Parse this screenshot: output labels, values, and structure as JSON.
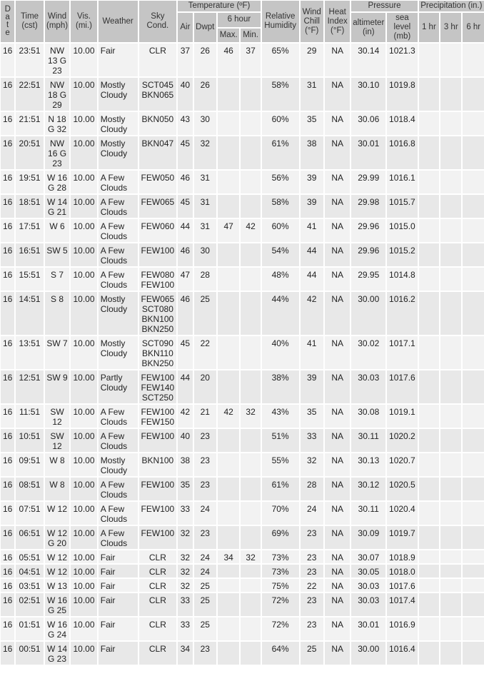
{
  "headers": {
    "date": "D a t e",
    "time": "Time (cst)",
    "wind": "Wind (mph)",
    "vis": "Vis. (mi.)",
    "weather": "Weather",
    "sky": "Sky Cond.",
    "temperature": "Temperature (ºF)",
    "air": "Air",
    "dwpt": "Dwpt",
    "six_hour": "6 hour",
    "max": "Max.",
    "min": "Min.",
    "humidity": "Relative Humidity",
    "wind_chill": "Wind Chill (°F)",
    "heat_index": "Heat Index (°F)",
    "pressure": "Pressure",
    "altimeter": "altimeter (in)",
    "sea_level": "sea level (mb)",
    "precipitation": "Precipitation (in.)",
    "p1": "1 hr",
    "p3": "3 hr",
    "p6": "6 hr"
  },
  "rows": [
    {
      "date": "16",
      "time": "23:51",
      "wind": "NW 13 G 23",
      "vis": "10.00",
      "weather": "Fair",
      "sky": [
        "CLR"
      ],
      "air": "37",
      "dwpt": "26",
      "max": "46",
      "min": "37",
      "rh": "65%",
      "chill": "29",
      "heat": "NA",
      "alt": "30.14",
      "sea": "1021.3",
      "p1": "",
      "p3": "",
      "p6": ""
    },
    {
      "date": "16",
      "time": "22:51",
      "wind": "NW 18 G 29",
      "vis": "10.00",
      "weather": "Mostly Cloudy",
      "sky": [
        "SCT045",
        "BKN065"
      ],
      "air": "40",
      "dwpt": "26",
      "max": "",
      "min": "",
      "rh": "58%",
      "chill": "31",
      "heat": "NA",
      "alt": "30.10",
      "sea": "1019.8",
      "p1": "",
      "p3": "",
      "p6": ""
    },
    {
      "date": "16",
      "time": "21:51",
      "wind": "N 18 G 32",
      "vis": "10.00",
      "weather": "Mostly Cloudy",
      "sky": [
        "BKN050"
      ],
      "air": "43",
      "dwpt": "30",
      "max": "",
      "min": "",
      "rh": "60%",
      "chill": "35",
      "heat": "NA",
      "alt": "30.06",
      "sea": "1018.4",
      "p1": "",
      "p3": "",
      "p6": ""
    },
    {
      "date": "16",
      "time": "20:51",
      "wind": "NW 16 G 23",
      "vis": "10.00",
      "weather": "Mostly Cloudy",
      "sky": [
        "BKN047"
      ],
      "air": "45",
      "dwpt": "32",
      "max": "",
      "min": "",
      "rh": "61%",
      "chill": "38",
      "heat": "NA",
      "alt": "30.01",
      "sea": "1016.8",
      "p1": "",
      "p3": "",
      "p6": ""
    },
    {
      "date": "16",
      "time": "19:51",
      "wind": "W 16 G 28",
      "vis": "10.00",
      "weather": "A Few Clouds",
      "sky": [
        "FEW050"
      ],
      "air": "46",
      "dwpt": "31",
      "max": "",
      "min": "",
      "rh": "56%",
      "chill": "39",
      "heat": "NA",
      "alt": "29.99",
      "sea": "1016.1",
      "p1": "",
      "p3": "",
      "p6": ""
    },
    {
      "date": "16",
      "time": "18:51",
      "wind": "W 14 G 21",
      "vis": "10.00",
      "weather": "A Few Clouds",
      "sky": [
        "FEW065"
      ],
      "air": "45",
      "dwpt": "31",
      "max": "",
      "min": "",
      "rh": "58%",
      "chill": "39",
      "heat": "NA",
      "alt": "29.98",
      "sea": "1015.7",
      "p1": "",
      "p3": "",
      "p6": ""
    },
    {
      "date": "16",
      "time": "17:51",
      "wind": "W 6",
      "vis": "10.00",
      "weather": "A Few Clouds",
      "sky": [
        "FEW060"
      ],
      "air": "44",
      "dwpt": "31",
      "max": "47",
      "min": "42",
      "rh": "60%",
      "chill": "41",
      "heat": "NA",
      "alt": "29.96",
      "sea": "1015.0",
      "p1": "",
      "p3": "",
      "p6": ""
    },
    {
      "date": "16",
      "time": "16:51",
      "wind": "SW 5",
      "vis": "10.00",
      "weather": "A Few Clouds",
      "sky": [
        "FEW100"
      ],
      "air": "46",
      "dwpt": "30",
      "max": "",
      "min": "",
      "rh": "54%",
      "chill": "44",
      "heat": "NA",
      "alt": "29.96",
      "sea": "1015.2",
      "p1": "",
      "p3": "",
      "p6": ""
    },
    {
      "date": "16",
      "time": "15:51",
      "wind": "S 7",
      "vis": "10.00",
      "weather": "A Few Clouds",
      "sky": [
        "FEW080",
        "FEW100"
      ],
      "air": "47",
      "dwpt": "28",
      "max": "",
      "min": "",
      "rh": "48%",
      "chill": "44",
      "heat": "NA",
      "alt": "29.95",
      "sea": "1014.8",
      "p1": "",
      "p3": "",
      "p6": ""
    },
    {
      "date": "16",
      "time": "14:51",
      "wind": "S 8",
      "vis": "10.00",
      "weather": "Mostly Cloudy",
      "sky": [
        "FEW065",
        "SCT080",
        "BKN100",
        "BKN250"
      ],
      "air": "46",
      "dwpt": "25",
      "max": "",
      "min": "",
      "rh": "44%",
      "chill": "42",
      "heat": "NA",
      "alt": "30.00",
      "sea": "1016.2",
      "p1": "",
      "p3": "",
      "p6": ""
    },
    {
      "date": "16",
      "time": "13:51",
      "wind": "SW 7",
      "vis": "10.00",
      "weather": "Mostly Cloudy",
      "sky": [
        "SCT090",
        "BKN110",
        "BKN250"
      ],
      "air": "45",
      "dwpt": "22",
      "max": "",
      "min": "",
      "rh": "40%",
      "chill": "41",
      "heat": "NA",
      "alt": "30.02",
      "sea": "1017.1",
      "p1": "",
      "p3": "",
      "p6": ""
    },
    {
      "date": "16",
      "time": "12:51",
      "wind": "SW 9",
      "vis": "10.00",
      "weather": "Partly Cloudy",
      "sky": [
        "FEW100",
        "FEW140",
        "SCT250"
      ],
      "air": "44",
      "dwpt": "20",
      "max": "",
      "min": "",
      "rh": "38%",
      "chill": "39",
      "heat": "NA",
      "alt": "30.03",
      "sea": "1017.6",
      "p1": "",
      "p3": "",
      "p6": ""
    },
    {
      "date": "16",
      "time": "11:51",
      "wind": "SW 12",
      "vis": "10.00",
      "weather": "A Few Clouds",
      "sky": [
        "FEW100",
        "FEW150"
      ],
      "air": "42",
      "dwpt": "21",
      "max": "42",
      "min": "32",
      "rh": "43%",
      "chill": "35",
      "heat": "NA",
      "alt": "30.08",
      "sea": "1019.1",
      "p1": "",
      "p3": "",
      "p6": ""
    },
    {
      "date": "16",
      "time": "10:51",
      "wind": "SW 12",
      "vis": "10.00",
      "weather": "A Few Clouds",
      "sky": [
        "FEW100"
      ],
      "air": "40",
      "dwpt": "23",
      "max": "",
      "min": "",
      "rh": "51%",
      "chill": "33",
      "heat": "NA",
      "alt": "30.11",
      "sea": "1020.2",
      "p1": "",
      "p3": "",
      "p6": ""
    },
    {
      "date": "16",
      "time": "09:51",
      "wind": "W 8",
      "vis": "10.00",
      "weather": "Mostly Cloudy",
      "sky": [
        "BKN100"
      ],
      "air": "38",
      "dwpt": "23",
      "max": "",
      "min": "",
      "rh": "55%",
      "chill": "32",
      "heat": "NA",
      "alt": "30.13",
      "sea": "1020.7",
      "p1": "",
      "p3": "",
      "p6": ""
    },
    {
      "date": "16",
      "time": "08:51",
      "wind": "W 8",
      "vis": "10.00",
      "weather": "A Few Clouds",
      "sky": [
        "FEW100"
      ],
      "air": "35",
      "dwpt": "23",
      "max": "",
      "min": "",
      "rh": "61%",
      "chill": "28",
      "heat": "NA",
      "alt": "30.12",
      "sea": "1020.5",
      "p1": "",
      "p3": "",
      "p6": ""
    },
    {
      "date": "16",
      "time": "07:51",
      "wind": "W 12",
      "vis": "10.00",
      "weather": "A Few Clouds",
      "sky": [
        "FEW100"
      ],
      "air": "33",
      "dwpt": "24",
      "max": "",
      "min": "",
      "rh": "70%",
      "chill": "24",
      "heat": "NA",
      "alt": "30.11",
      "sea": "1020.4",
      "p1": "",
      "p3": "",
      "p6": ""
    },
    {
      "date": "16",
      "time": "06:51",
      "wind": "W 12 G 20",
      "vis": "10.00",
      "weather": "A Few Clouds",
      "sky": [
        "FEW100"
      ],
      "air": "32",
      "dwpt": "23",
      "max": "",
      "min": "",
      "rh": "69%",
      "chill": "23",
      "heat": "NA",
      "alt": "30.09",
      "sea": "1019.7",
      "p1": "",
      "p3": "",
      "p6": ""
    },
    {
      "date": "16",
      "time": "05:51",
      "wind": "W 12",
      "vis": "10.00",
      "weather": "Fair",
      "sky": [
        "CLR"
      ],
      "air": "32",
      "dwpt": "24",
      "max": "34",
      "min": "32",
      "rh": "73%",
      "chill": "23",
      "heat": "NA",
      "alt": "30.07",
      "sea": "1018.9",
      "p1": "",
      "p3": "",
      "p6": ""
    },
    {
      "date": "16",
      "time": "04:51",
      "wind": "W 12",
      "vis": "10.00",
      "weather": "Fair",
      "sky": [
        "CLR"
      ],
      "air": "32",
      "dwpt": "24",
      "max": "",
      "min": "",
      "rh": "73%",
      "chill": "23",
      "heat": "NA",
      "alt": "30.05",
      "sea": "1018.0",
      "p1": "",
      "p3": "",
      "p6": ""
    },
    {
      "date": "16",
      "time": "03:51",
      "wind": "W 13",
      "vis": "10.00",
      "weather": "Fair",
      "sky": [
        "CLR"
      ],
      "air": "32",
      "dwpt": "25",
      "max": "",
      "min": "",
      "rh": "75%",
      "chill": "22",
      "heat": "NA",
      "alt": "30.03",
      "sea": "1017.6",
      "p1": "",
      "p3": "",
      "p6": ""
    },
    {
      "date": "16",
      "time": "02:51",
      "wind": "W 16 G 25",
      "vis": "10.00",
      "weather": "Fair",
      "sky": [
        "CLR"
      ],
      "air": "33",
      "dwpt": "25",
      "max": "",
      "min": "",
      "rh": "72%",
      "chill": "23",
      "heat": "NA",
      "alt": "30.03",
      "sea": "1017.4",
      "p1": "",
      "p3": "",
      "p6": ""
    },
    {
      "date": "16",
      "time": "01:51",
      "wind": "W 16 G 24",
      "vis": "10.00",
      "weather": "Fair",
      "sky": [
        "CLR"
      ],
      "air": "33",
      "dwpt": "25",
      "max": "",
      "min": "",
      "rh": "72%",
      "chill": "23",
      "heat": "NA",
      "alt": "30.01",
      "sea": "1016.9",
      "p1": "",
      "p3": "",
      "p6": ""
    },
    {
      "date": "16",
      "time": "00:51",
      "wind": "W 14 G 23",
      "vis": "10.00",
      "weather": "Fair",
      "sky": [
        "CLR"
      ],
      "air": "34",
      "dwpt": "23",
      "max": "",
      "min": "",
      "rh": "64%",
      "chill": "25",
      "heat": "NA",
      "alt": "30.00",
      "sea": "1016.4",
      "p1": "",
      "p3": "",
      "p6": ""
    }
  ]
}
